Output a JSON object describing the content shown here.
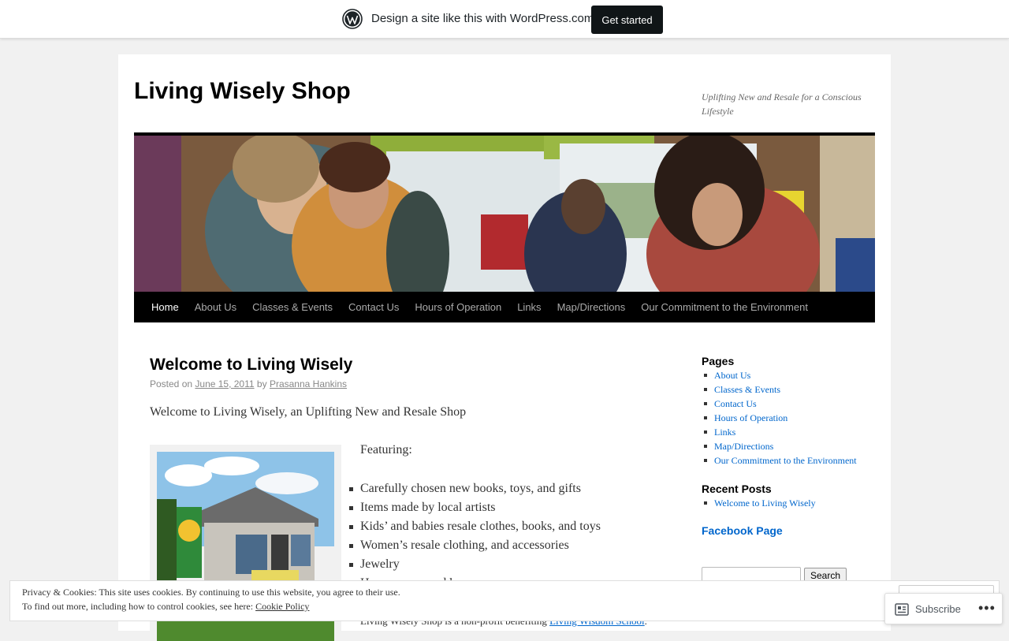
{
  "wp_banner": {
    "text": "Design a site like this with WordPress.com",
    "button": "Get started"
  },
  "site": {
    "title": "Living Wisely Shop",
    "description": "Uplifting New and Resale for a Conscious Lifestyle"
  },
  "nav": {
    "items": [
      "Home",
      "About Us",
      "Classes & Events",
      "Contact Us",
      "Hours of Operation",
      "Links",
      "Map/Directions",
      "Our Commitment to the Environment"
    ],
    "active": "Home"
  },
  "post": {
    "title": "Welcome to Living Wisely",
    "posted_on": "Posted on",
    "date": "June 15, 2011",
    "by": "by",
    "author": "Prasanna Hankins",
    "intro": "Welcome to Living Wisely, an Uplifting New and Resale Shop",
    "featuring": "Featuring:",
    "features": [
      "Carefully chosen new books, toys, and gifts",
      "Items made by local artists",
      "Kids’ and babies resale clothes, books, and toys",
      "Women’s resale clothing, and accessories",
      "Jewelry",
      "Housewares, and home"
    ],
    "nonprofit_text": "Living Wisely Shop is a non-profit benefiting",
    "nonprofit_link": "Living Wisdom School",
    "nonprofit_end": "."
  },
  "sidebar": {
    "pages_heading": "Pages",
    "pages": [
      "About Us",
      "Classes & Events",
      "Contact Us",
      "Hours of Operation",
      "Links",
      "Map/Directions",
      "Our Commitment to the Environment"
    ],
    "recent_heading": "Recent Posts",
    "recent": [
      "Welcome to Living Wisely"
    ],
    "facebook": "Facebook Page",
    "search_value": "",
    "search_button": "Search"
  },
  "cookie": {
    "line1": "Privacy & Cookies: This site uses cookies. By continuing to use this website, you agree to their use.",
    "line2": "To find out more, including how to control cookies, see here:",
    "policy_link": "Cookie Policy"
  },
  "subscribe": {
    "label": "Subscribe",
    "more": "•••"
  },
  "colors": {
    "link": "#0066cc",
    "nav_bg": "#000000",
    "page_bg": "#f1f1f1",
    "button_dark": "#101517"
  },
  "icons": {
    "wordpress": "wordpress-logo-icon",
    "subscribe": "reader-icon"
  }
}
